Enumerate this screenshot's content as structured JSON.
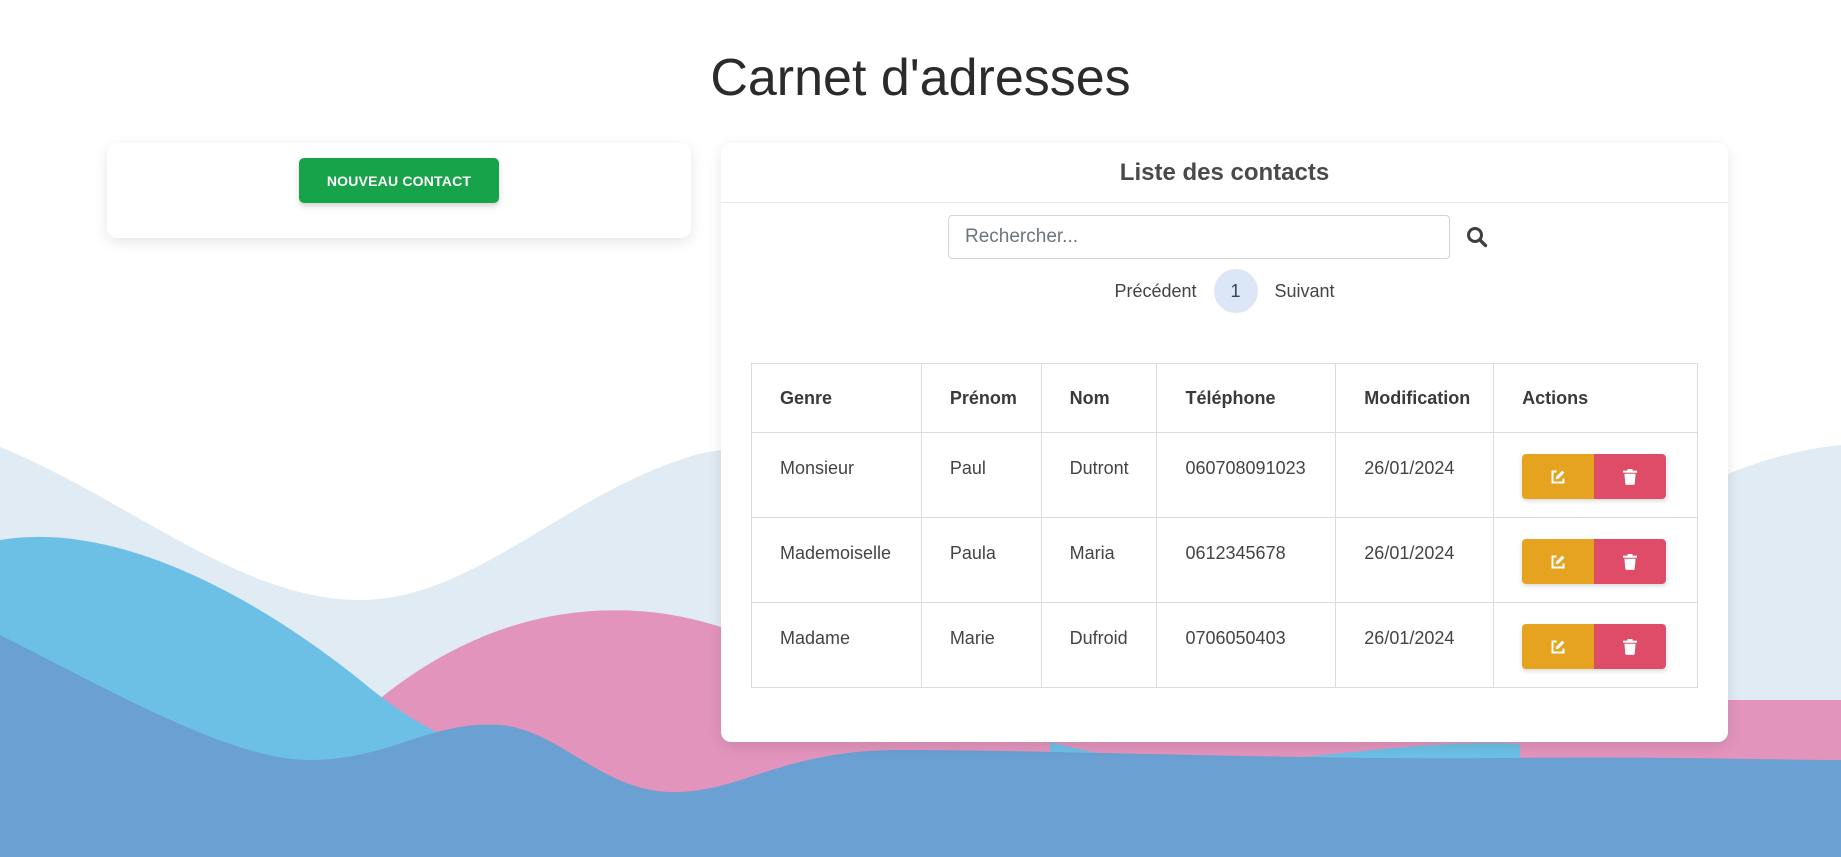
{
  "header": {
    "title": "Carnet d'adresses"
  },
  "sidebar": {
    "new_contact_label": "NOUVEAU CONTACT"
  },
  "contacts": {
    "title": "Liste des contacts",
    "search": {
      "placeholder": "Rechercher...",
      "value": "",
      "icon": "search-icon"
    },
    "pagination": {
      "previous": "Précédent",
      "current_page": "1",
      "next": "Suivant"
    },
    "columns": [
      "Genre",
      "Prénom",
      "Nom",
      "Téléphone",
      "Modification",
      "Actions"
    ],
    "rows": [
      {
        "genre": "Monsieur",
        "prenom": "Paul",
        "nom": "Dutront",
        "telephone": "060708091023",
        "modification": "26/01/2024"
      },
      {
        "genre": "Mademoiselle",
        "prenom": "Paula",
        "nom": "Maria",
        "telephone": "0612345678",
        "modification": "26/01/2024"
      },
      {
        "genre": "Madame",
        "prenom": "Marie",
        "nom": "Dufroid",
        "telephone": "0706050403",
        "modification": "26/01/2024"
      }
    ],
    "row_actions": {
      "edit_icon": "edit-icon",
      "delete_icon": "trash-icon"
    }
  },
  "colors": {
    "primary_green": "#17a34a",
    "edit_orange": "#e5a320",
    "delete_red": "#df4c68",
    "wave_light": "#e0ebf3",
    "wave_cyan": "#6cc0e5",
    "wave_pink": "#e294bc",
    "wave_blue": "#6aa0d2"
  }
}
